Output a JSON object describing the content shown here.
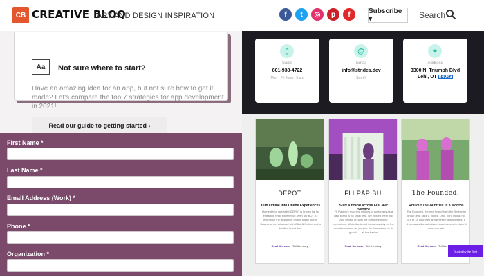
{
  "header": {
    "logo_mark": "CB",
    "logo_text": "CREATIVE BLOQ",
    "tagline": "ART AND DESIGN INSPIRATION",
    "social": [
      {
        "name": "facebook-icon",
        "glyph": "f",
        "color": "#3b5998"
      },
      {
        "name": "twitter-icon",
        "glyph": "t",
        "color": "#1da1f2"
      },
      {
        "name": "instagram-icon",
        "glyph": "◎",
        "color": "#e1306c"
      },
      {
        "name": "pinterest-icon",
        "glyph": "p",
        "color": "#cb2027"
      },
      {
        "name": "flipboard-icon",
        "glyph": "f",
        "color": "#e12828"
      }
    ],
    "subscribe_label": "Subscribe ▾",
    "search_label": "Search"
  },
  "promo": {
    "icon_text": "Aa",
    "title": "Not sure where to start?",
    "description": "Have an amazing idea for an app, but not sure how to get it made? Let's compare the top 7 strategies for app development in 2021!",
    "button_label": "Read our guide to getting started ›"
  },
  "form": {
    "fields": [
      {
        "label": "First Name *"
      },
      {
        "label": "Last Name *"
      },
      {
        "label": "Email Address (Work) *"
      },
      {
        "label": "Phone *"
      },
      {
        "label": "Organization *"
      }
    ]
  },
  "contact": {
    "cards": [
      {
        "icon": "▯",
        "icon_name": "phone-icon",
        "label": "Sales",
        "value": "801-938-4722",
        "sub": "Mon - Fri 9 am - 5 pm"
      },
      {
        "icon": "@",
        "icon_name": "email-icon",
        "label": "Email",
        "value": "info@strides.dev",
        "sub": "Say Hi"
      },
      {
        "icon": "⌖",
        "icon_name": "location-icon",
        "label": "Address",
        "value_line1": "3300 N. Triumph Blvd",
        "value_line2_prefix": "Lehi, UT ",
        "value_line2_highlight": "84043",
        "sub": ""
      }
    ]
  },
  "work": {
    "cards": [
      {
        "brand": "DEPOT",
        "title": "Turn Offline Into Online Experiences",
        "desc": "Home décor specialist DEPOT is known for its engaging retail experience. With our BOTTO extension the ambiance on the digital world. Seamless omnichannel with Click & Collect and a detailed brand feel.",
        "link1": "Read the case",
        "link2": "Tell the story",
        "img": "img-depot"
      },
      {
        "brand": "FLI PĀPIBU",
        "title": "Start a Brand across Full 360° Service",
        "desc": "Fli Papibu's reaching millions of customers as a new brand is no small feat. We helped them find and setting up with the complete online operations. While the brand focuses solely on the creative content we provide the foundation for its growth — all the basics.",
        "link1": "Read the case",
        "link2": "Tell the story",
        "img": "img-fli"
      },
      {
        "brand": "The Founded.",
        "title": "Roll out 18 Countries in 3 Months",
        "desc": "The Founded, the new brand from the Bestseller group (e.g. Jack & Jones, Only, Vero Moda) roll out to 18 countries and entered new markets. It showcases the software reused across to place it on a new site.",
        "link1": "Read the case",
        "link2": "Tell the story",
        "img": "img-founded"
      }
    ]
  },
  "chip": {
    "label": "Trusted by the Best"
  }
}
